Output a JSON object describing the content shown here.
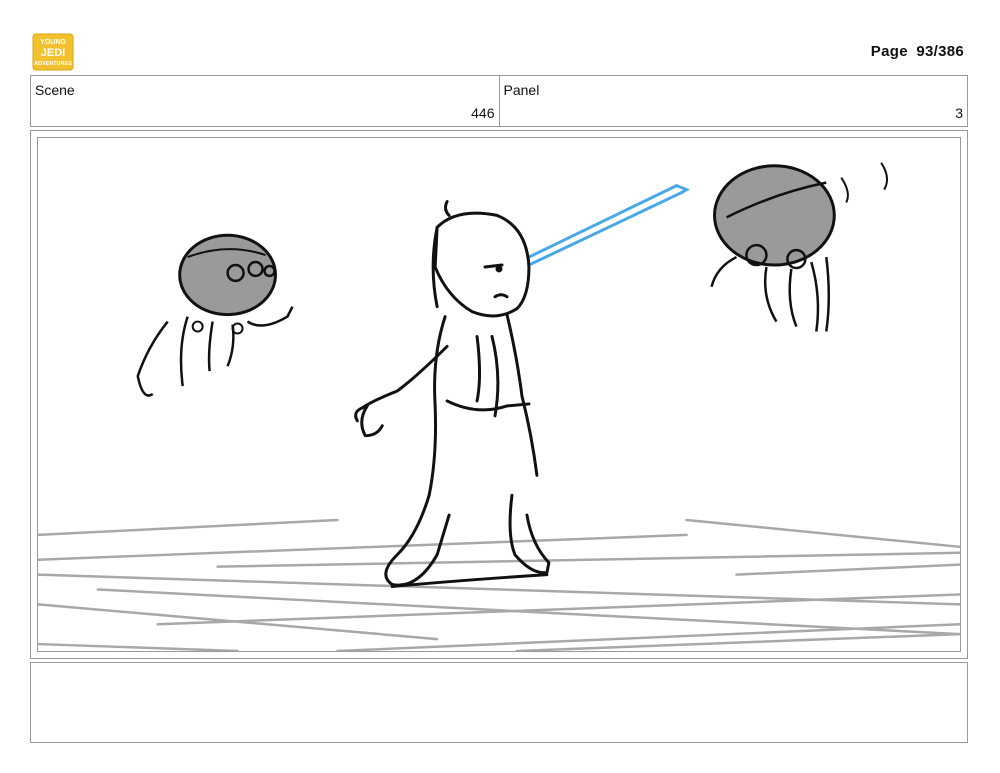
{
  "header": {
    "logo_text": [
      "YOUNG",
      "JEDI",
      "ADVENTURES"
    ],
    "page_label": "Page",
    "page_value": "93/386"
  },
  "info": {
    "scene_label": "Scene",
    "scene_value": "446",
    "panel_label": "Panel",
    "panel_value": "3"
  },
  "colors": {
    "saber": "#4aa8e8",
    "droid_fill": "#9a9a9a",
    "floor_lines": "#a8a8a8",
    "logo": "#f2c12e"
  },
  "notes": {
    "text": ""
  }
}
